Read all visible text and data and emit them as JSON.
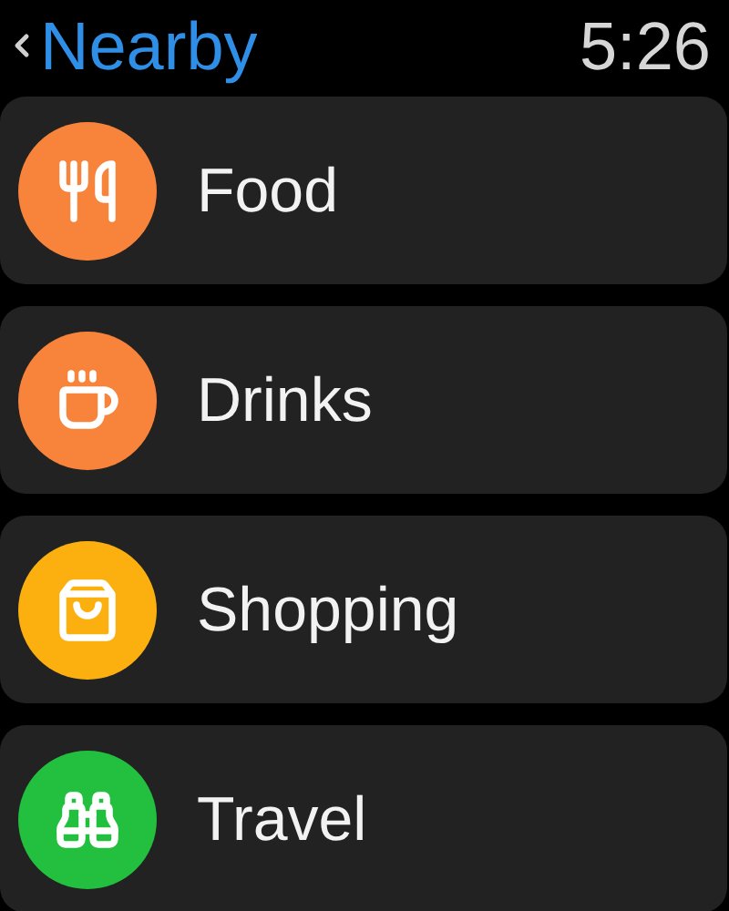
{
  "header": {
    "back_label": "Nearby",
    "time": "5:26"
  },
  "items": [
    {
      "label": "Food",
      "kind": "food",
      "color": "#f7843a"
    },
    {
      "label": "Drinks",
      "kind": "drinks",
      "color": "#f7843a"
    },
    {
      "label": "Shopping",
      "kind": "shopping",
      "color": "#fcb00f"
    },
    {
      "label": "Travel",
      "kind": "travel",
      "color": "#22c03e"
    }
  ]
}
